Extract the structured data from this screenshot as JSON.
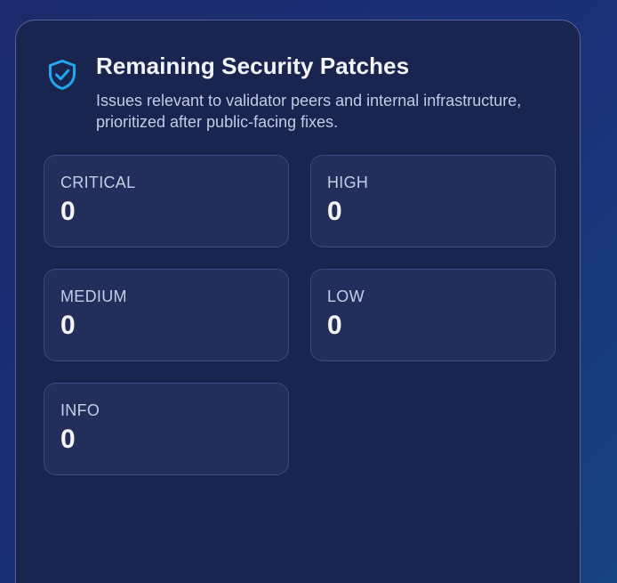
{
  "panel": {
    "title": "Remaining Security Patches",
    "subtitle": "Issues relevant to validator peers and internal infrastructure, prioritized after public-facing fixes.",
    "icon": "shield-check-icon",
    "accent_color": "#1fa8f0"
  },
  "stats": [
    {
      "label": "CRITICAL",
      "value": "0"
    },
    {
      "label": "HIGH",
      "value": "0"
    },
    {
      "label": "MEDIUM",
      "value": "0"
    },
    {
      "label": "LOW",
      "value": "0"
    },
    {
      "label": "INFO",
      "value": "0"
    }
  ]
}
